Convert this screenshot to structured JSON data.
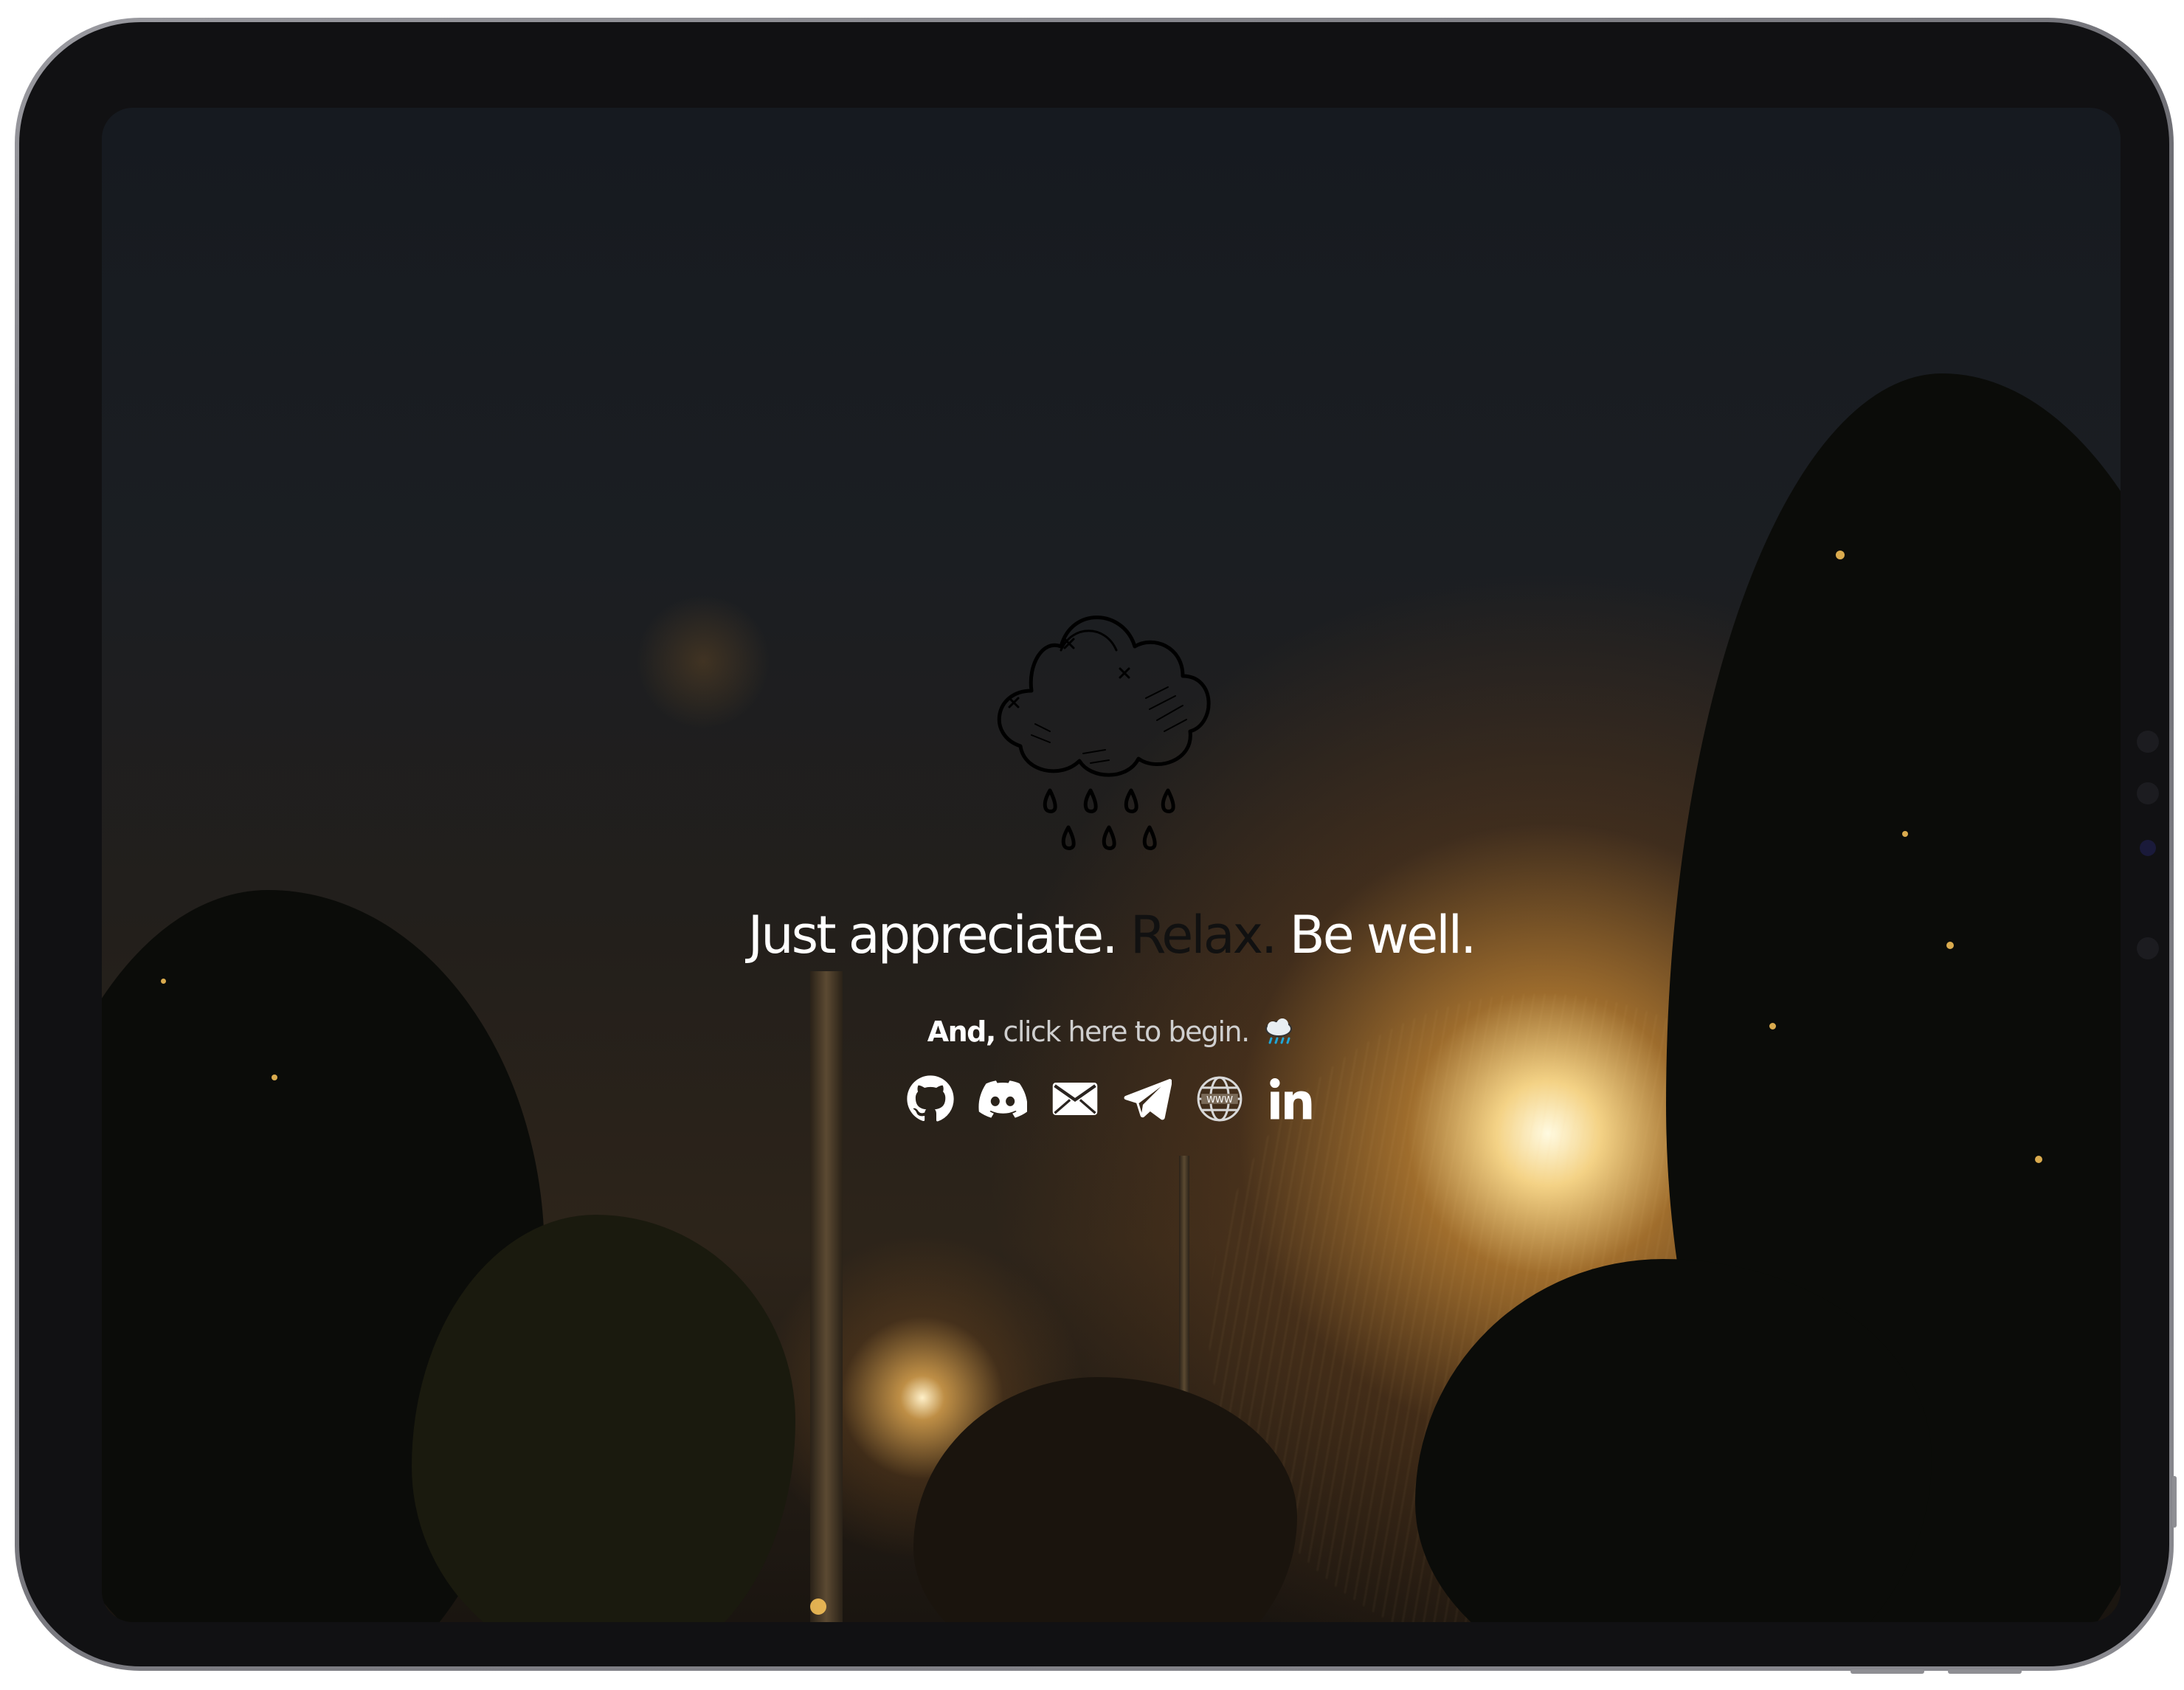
{
  "device": {
    "type": "iPad"
  },
  "hero": {
    "tagline_part1": "Just appreciate.",
    "tagline_part2": "Relax.",
    "tagline_part3": "Be well.",
    "sub_lead": "And,",
    "sub_link": "click here to begin.",
    "logo_icon": "rain-cloud-icon"
  },
  "socials": [
    {
      "icon": "github-icon"
    },
    {
      "icon": "discord-icon"
    },
    {
      "icon": "email-icon"
    },
    {
      "icon": "telegram-icon"
    },
    {
      "icon": "website-icon"
    },
    {
      "icon": "linkedin-icon"
    }
  ],
  "colors": {
    "text_primary": "#ffffff",
    "text_dark": "#111111",
    "link": "#cfcfcf",
    "lamp_glow": "#ffd98c"
  }
}
